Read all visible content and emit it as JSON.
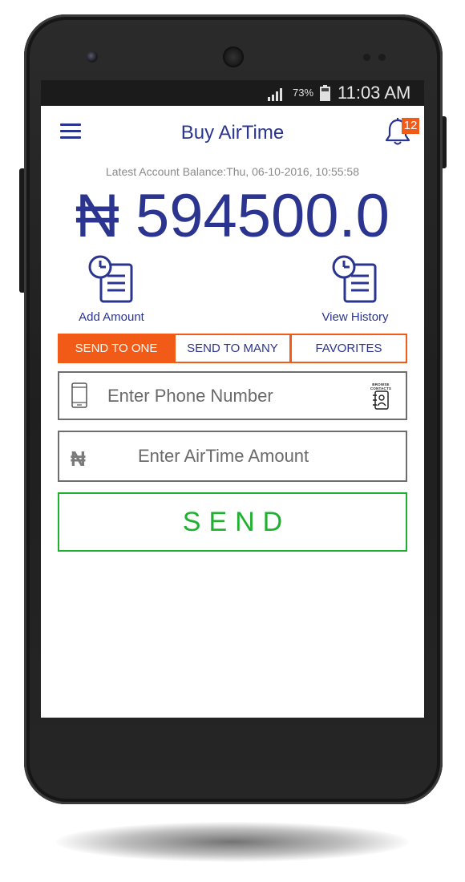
{
  "status_bar": {
    "battery_percent": "73%",
    "time": "11:03 AM",
    "signal_icon": "signal-icon",
    "battery_icon": "battery-icon"
  },
  "app_bar": {
    "title": "Buy AirTime",
    "menu_icon": "hamburger-menu-icon",
    "notification_icon": "bell-icon",
    "notification_count": "12"
  },
  "balance": {
    "label": "Latest Account Balance:Thu, 06-10-2016, 10:55:58",
    "currency_symbol": "₦",
    "amount": "594500.0"
  },
  "actions": {
    "add_amount_label": "Add Amount",
    "view_history_label": "View History",
    "icon": "clock-document-icon"
  },
  "tabs": [
    {
      "label": "SEND TO ONE",
      "active": true
    },
    {
      "label": "SEND TO MANY",
      "active": false
    },
    {
      "label": "FAVORITES",
      "active": false
    }
  ],
  "form": {
    "phone_placeholder": "Enter Phone Number",
    "phone_value": "",
    "browse_contacts_label": "BROWSE CONTACTS",
    "amount_placeholder": "Enter AirTime Amount",
    "amount_value": "",
    "amount_currency_symbol": "₦",
    "send_label": "SEND"
  },
  "colors": {
    "primary": "#2b3590",
    "accent": "#f25a18",
    "send": "#1db12f"
  }
}
